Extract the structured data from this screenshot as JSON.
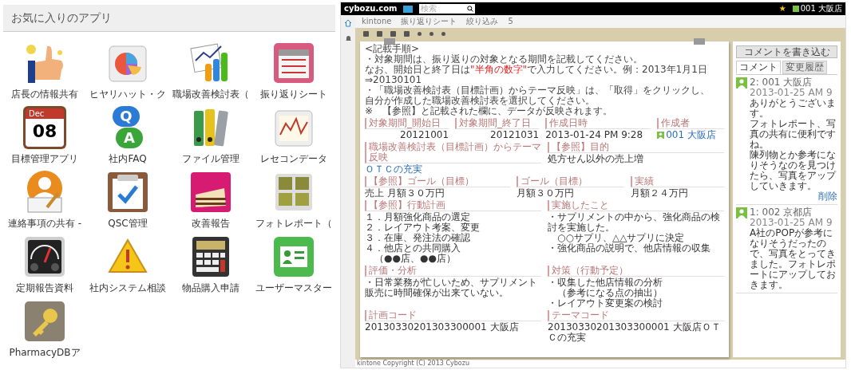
{
  "favorites": {
    "title": "お気に入りのアプリ",
    "apps": [
      {
        "label": "店長の情報共有"
      },
      {
        "label": "ヒヤリハット・ク"
      },
      {
        "label": "職場改善検討表（"
      },
      {
        "label": "振り返りシート"
      },
      {
        "label": "目標管理アプリ",
        "icon_texts": [
          "Dec",
          "08"
        ]
      },
      {
        "label": "社内FAQ",
        "icon_texts": [
          "Q",
          "A"
        ]
      },
      {
        "label": "ファイル管理"
      },
      {
        "label": "レセコンデータ"
      },
      {
        "label": "連絡事項の共有 -"
      },
      {
        "label": "QSC管理"
      },
      {
        "label": "改善報告"
      },
      {
        "label": "フォトレポート（"
      },
      {
        "label": "定期報告資料"
      },
      {
        "label": "社内システム相談"
      },
      {
        "label": "物品購入申請"
      },
      {
        "label": "ユーザーマスター"
      },
      {
        "label": "PharmacyDBア"
      }
    ]
  },
  "kintone_window": {
    "logo": "cybozu.com",
    "search": {
      "placeholder": "検索"
    },
    "user": "001 大阪店",
    "breadcrumbs": [
      "kintone",
      "振り返りシート",
      "絞り込み",
      "5"
    ],
    "record": {
      "instructions": [
        [
          {
            "kind": "plain",
            "text": "<記載手順>"
          }
        ],
        [
          {
            "kind": "plain",
            "text": "・対象期間は、振り返りの対象となる期間を記載してください。"
          }
        ],
        [
          {
            "kind": "plain",
            "text": "なお、開始日と終了日は"
          },
          {
            "kind": "highlight",
            "text": "\"半角の数字\""
          },
          {
            "kind": "plain",
            "text": "で入力してください。例：2013年1月1日⇒20130101"
          }
        ],
        [
          {
            "kind": "plain",
            "text": "・「職場改善検討表（目標計画）からテーマ反映」は、「取得」をクリックし、"
          }
        ],
        [
          {
            "kind": "plain",
            "text": "自分が作成した職場改善検討表を選択してください。"
          }
        ],
        [
          {
            "kind": "plain",
            "text": "※　【参照】と記載された欄に、データが反映されます。"
          }
        ]
      ],
      "rows": [
        [
          {
            "label": "対象期間_開始日",
            "value": "20121001",
            "kind": "number"
          },
          {
            "label": "対象期間_終了日",
            "value": "20121031",
            "kind": "number"
          },
          {
            "label": "作成日時",
            "value": "2013-01-24 PM 9:28",
            "kind": "text"
          },
          {
            "label": "作成者",
            "value": "001 大阪店",
            "kind": "user"
          }
        ],
        [
          {
            "label": "職場改善検討表（目標計画）からテーマ反映",
            "value": "ＯＴＣの充実",
            "kind": "link"
          },
          {
            "label": "【参照】目的",
            "value": "処方せん以外の売上増",
            "kind": "text"
          }
        ],
        [
          {
            "label": "【参照】ゴール（目標）",
            "value": "売上 月額３０万円",
            "kind": "text"
          },
          {
            "label": "ゴール（目標）",
            "value": "月額３０万円",
            "kind": "text"
          },
          {
            "label": "実績",
            "value": "月額２４万円",
            "kind": "text"
          }
        ],
        [
          {
            "label": "【参照】行動計画",
            "lines": [
              "１．月額強化商品の選定",
              "２．レイアウト考案、変更",
              "３．在庫、発注法の確認",
              "４．他店との共同購入",
              "　（●●店、●●店）"
            ],
            "kind": "lines"
          },
          {
            "label": "実施したこと",
            "lines": [
              "・サプリメントの中から、強化商品の検討を実施した。",
              "　○○サプリ、△△サプリに決定",
              "・強化商品の説明で、他店情報の収集"
            ],
            "kind": "lines"
          }
        ],
        [
          {
            "label": "評価・分析",
            "value": "・日常業務が忙しいため、サプリメント販売に時間確保が出来ていない。",
            "kind": "text"
          },
          {
            "label": "対策（行動予定）",
            "lines": [
              "・収集した他店情報の分析",
              "　（参考になる点の抽出）",
              "・レイアウト変更案の検討"
            ],
            "kind": "lines"
          }
        ],
        [
          {
            "label": "計画コード",
            "value": "20130330201303300001 大阪店",
            "kind": "text"
          },
          {
            "label": "テーマコード",
            "value": "20130330201303300001 大阪店ＯＴＣの充実",
            "kind": "text"
          }
        ]
      ]
    },
    "comments": {
      "write_button": "コメントを書き込む",
      "tabs": [
        {
          "label": "コメント",
          "selected": true
        },
        {
          "label": "変更履歴",
          "selected": false
        }
      ],
      "items": [
        {
          "author": "2: 001 大阪店",
          "time": "2013-01-25 AM 9",
          "lines": [
            "ありがとうございます。",
            "フォトレポート、写真の共有に便利ですね。",
            "陳列物とか参考になりそうなのを見つけたら、写真をアップしていきます。"
          ],
          "action": "削除"
        },
        {
          "author": "1: 002 京都店",
          "time": "2013-01-25 AM 9",
          "lines": [
            "A社のPOPが参考になりそうだったので、写真をとってきました。フォトレポートにアップしておきます。"
          ]
        }
      ]
    },
    "favorites_star": "★",
    "footer": "kintone Copyright (C) 2013 Cybozu"
  }
}
